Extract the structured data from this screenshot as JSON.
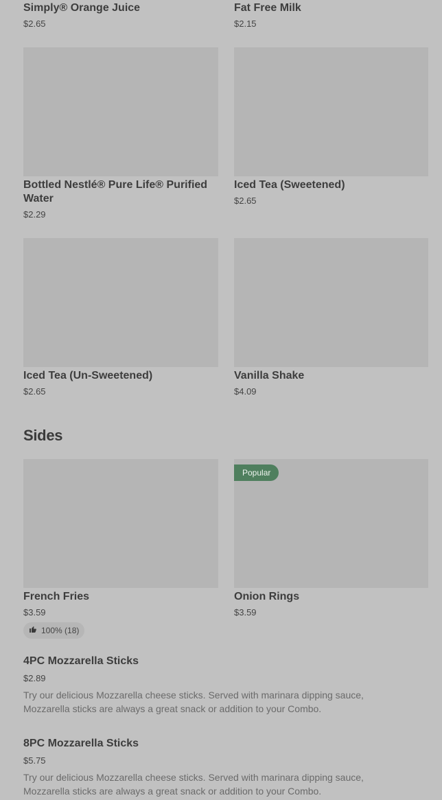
{
  "drinks": [
    {
      "name": "Simply® Orange Juice",
      "price": "$2.65"
    },
    {
      "name": "Fat Free Milk",
      "price": "$2.15"
    },
    {
      "name": "Bottled Nestlé® Pure Life® Purified Water",
      "price": "$2.29"
    },
    {
      "name": "Iced Tea (Sweetened)",
      "price": "$2.65"
    },
    {
      "name": "Iced Tea (Un-Sweetened)",
      "price": "$2.65"
    },
    {
      "name": "Vanilla Shake",
      "price": "$4.09"
    }
  ],
  "sides": {
    "title": "Sides",
    "cards": [
      {
        "name": "French Fries",
        "price": "$3.59",
        "rating": "100% (18)",
        "rating_icon": "thumbs-up-icon"
      },
      {
        "name": "Onion Rings",
        "price": "$3.59",
        "badge": "Popular"
      }
    ],
    "list": [
      {
        "name": "4PC Mozzarella Sticks",
        "price": "$2.89",
        "desc": "Try our delicious Mozzarella cheese sticks. Served with marinara dipping sauce, Mozzarella sticks are always a great snack or addition to your Combo."
      },
      {
        "name": "8PC Mozzarella Sticks",
        "price": "$5.75",
        "desc": "Try our delicious Mozzarella cheese sticks. Served with marinara dipping sauce, Mozzarella sticks are always a great snack or addition to your Combo."
      }
    ]
  },
  "colors": {
    "background": "#c1c1c1",
    "image_placeholder": "#b5b5b5",
    "popular_badge": "#4f7f5e"
  }
}
